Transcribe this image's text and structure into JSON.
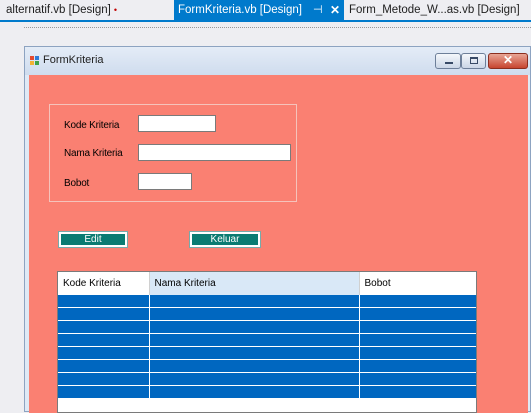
{
  "ide": {
    "tabs": [
      {
        "label": "alternatif.vb [Design]",
        "modified_marker": "•"
      },
      {
        "label": "FormKriteria.vb [Design]",
        "pin": "⊣",
        "close": "✕"
      },
      {
        "label": "Form_Metode_W...as.vb [Design]"
      }
    ],
    "active_tab_color": "#007acc"
  },
  "window": {
    "title": "FormKriteria",
    "controls": {
      "minimize": "",
      "maximize": "",
      "close": "✕"
    }
  },
  "form": {
    "background": "#fa8072",
    "fields": {
      "kode_label": "Kode Kriteria",
      "kode_value": "",
      "nama_label": "Nama Kriteria",
      "nama_value": "",
      "bobot_label": "Bobot",
      "bobot_value": ""
    },
    "buttons": {
      "edit": "Edit",
      "keluar": "Keluar"
    },
    "button_color": "#0a7b72"
  },
  "grid": {
    "columns": [
      "Kode Kriteria",
      "Nama Kriteria",
      "Bobot",
      ""
    ],
    "row_color": "#0067c0",
    "rows": [
      [
        "",
        "",
        "",
        ""
      ],
      [
        "",
        "",
        "",
        ""
      ],
      [
        "",
        "",
        "",
        ""
      ],
      [
        "",
        "",
        "",
        ""
      ],
      [
        "",
        "",
        "",
        ""
      ],
      [
        "",
        "",
        "",
        ""
      ],
      [
        "",
        "",
        "",
        ""
      ],
      [
        "",
        "",
        "",
        ""
      ]
    ]
  }
}
